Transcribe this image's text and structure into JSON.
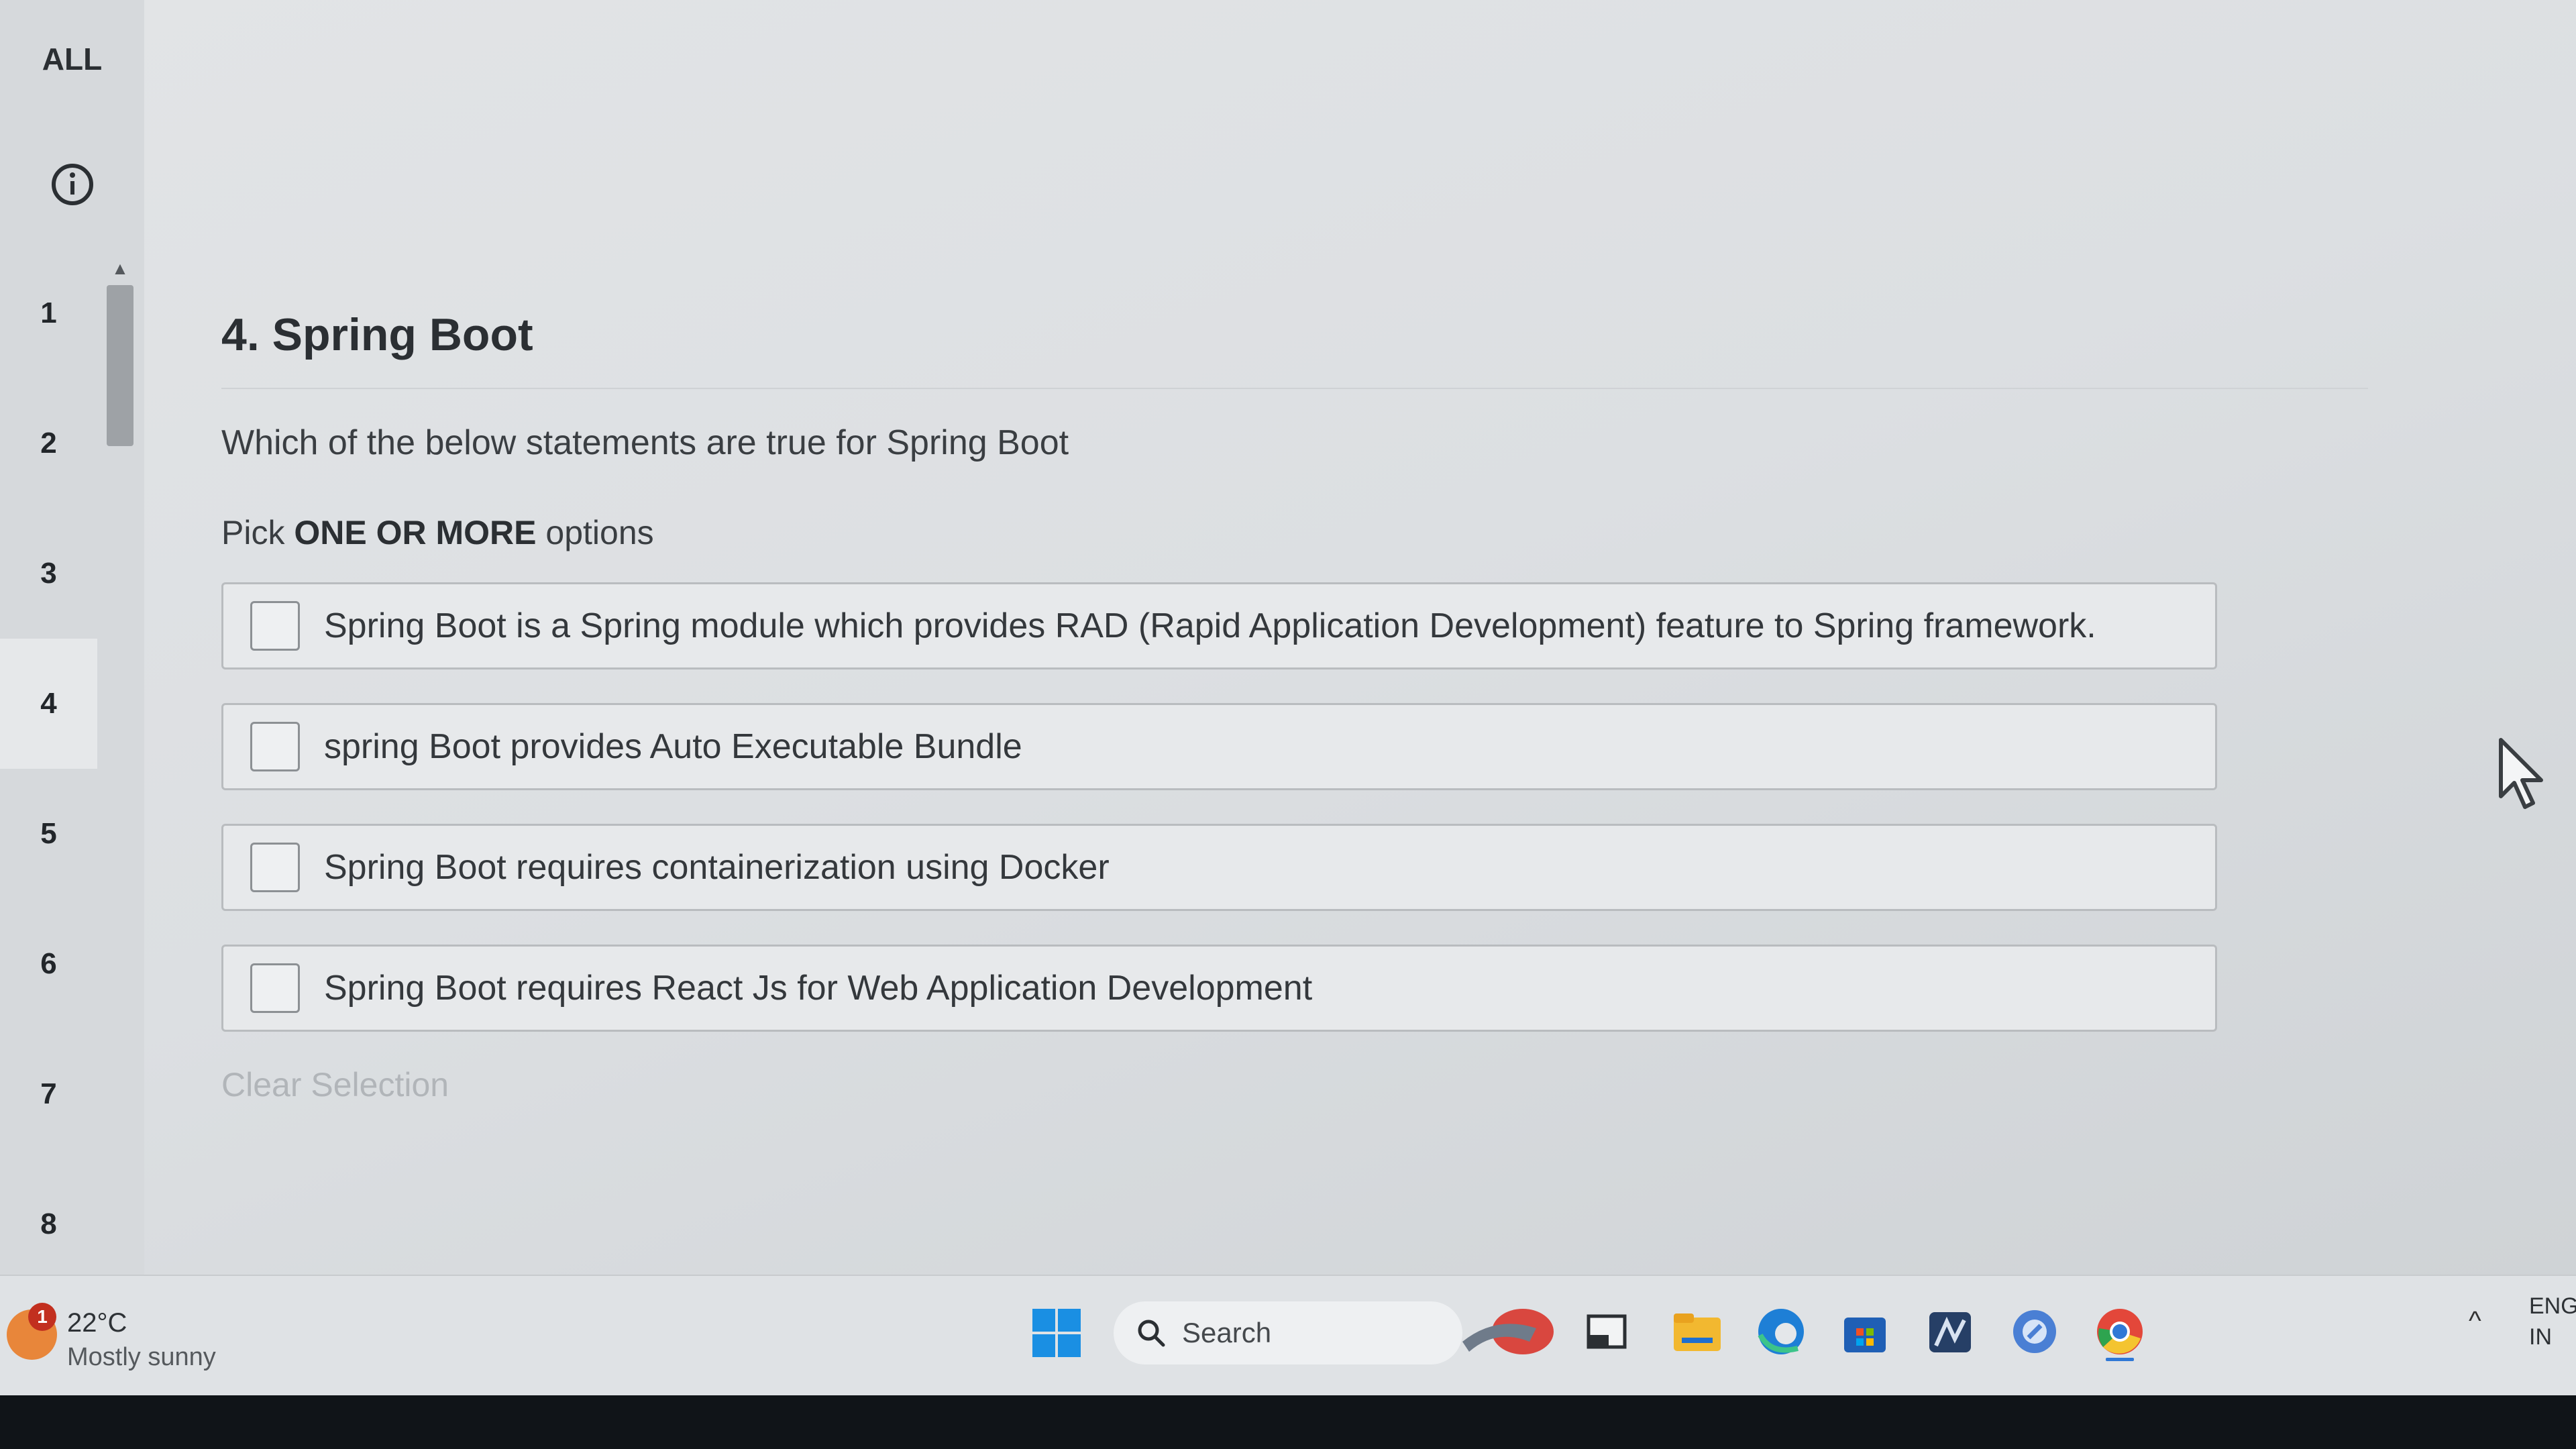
{
  "sidebar": {
    "all_label": "ALL",
    "info_icon": "info-icon",
    "questions": [
      "1",
      "2",
      "3",
      "4",
      "5",
      "6",
      "7",
      "8"
    ],
    "current_question": "4"
  },
  "question": {
    "title": "4. Spring Boot",
    "text": "Which of the below statements are true for Spring Boot",
    "hint_prefix": "Pick ",
    "hint_bold": "ONE OR MORE",
    "hint_suffix": " options",
    "options": [
      "Spring Boot is a Spring module which provides RAD (Rapid Application Development) feature to Spring framework.",
      "spring Boot provides Auto Executable Bundle",
      "Spring Boot requires containerization using Docker",
      "Spring Boot requires React Js for Web Application Development"
    ],
    "clear_label": "Clear Selection"
  },
  "taskbar": {
    "weather_badge": "1",
    "weather_temp": "22°C",
    "weather_condition": "Mostly sunny",
    "search_label": "Search",
    "apps": [
      "windows-start-icon",
      "search-icon",
      "widget-app-icon",
      "task-view-icon",
      "file-explorer-icon",
      "edge-icon",
      "store-icon",
      "app-icon",
      "app-icon-2",
      "chrome-icon"
    ],
    "tray_caret": "^",
    "lang_1": "ENG",
    "lang_2": "IN"
  },
  "colors": {
    "accent_start": "#1a8fe3",
    "edge": "#1e7fd6",
    "chrome_red": "#e3473a",
    "folder": "#f2b830"
  }
}
